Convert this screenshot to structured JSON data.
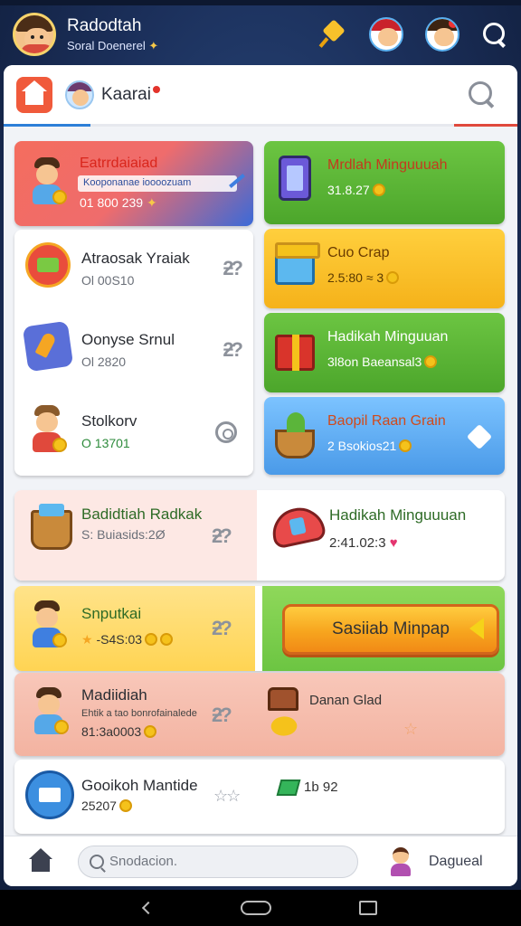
{
  "header": {
    "user_name": "Radodtah",
    "user_subtitle": "Soral Doenerel"
  },
  "panel": {
    "title": "Kaarai"
  },
  "featured": {
    "title": "Eatrrdaiaiad",
    "strip_text": "Kooponanae ioooozuam",
    "value": "01 800 239"
  },
  "left_list": [
    {
      "title": "Atraosak Yraiak",
      "subtitle": "Ol 00S10"
    },
    {
      "title": "Oonyse Srnul",
      "subtitle": "Ol 2820"
    },
    {
      "title": "Stolkorv",
      "subtitle": "O 13701"
    }
  ],
  "right_cards": [
    {
      "title": "Mrdlah Minguuuah",
      "subtitle": "31.8.27"
    },
    {
      "title": "Cuo Crap",
      "subtitle": "2.5:80 ≈ 3"
    },
    {
      "title": "Hadikah Minguuan",
      "subtitle": "3l8on Baeansal3"
    },
    {
      "title": "Baopil Raan Grain",
      "subtitle": "2 Bsokios21"
    }
  ],
  "wide_row_1": {
    "left_title": "Badidtiah Radkak",
    "left_subtitle": "S: Buiasids:2Ø",
    "right_title": "Hadikah Minguuuan",
    "right_subtitle": "2:41.02:3"
  },
  "wide_row_2": {
    "left_title": "Snputkai",
    "left_subtitle": "-S4S:03",
    "button_label": "Sasiiab Minpap"
  },
  "wide_row_3": {
    "left_title": "Madiidiah",
    "left_subtitle": "Ehtik a tao bonrofainalede",
    "left_value": "81:3a0003",
    "right_title": "Danan Glad"
  },
  "wide_row_4": {
    "left_title": "Gooikoh Mantide",
    "left_subtitle": "25207",
    "right_value": "1b 92"
  },
  "bottom_bar": {
    "search_placeholder": "Snodacion.",
    "label": "Dagueal"
  },
  "chevron_glyph": "ƻ?",
  "colors": {
    "accent_blue": "#2d7fd8",
    "accent_red": "#e0493c",
    "green_card": "#4ca62b",
    "yellow_card": "#f5b21a",
    "cta_orange": "#f18a16"
  }
}
